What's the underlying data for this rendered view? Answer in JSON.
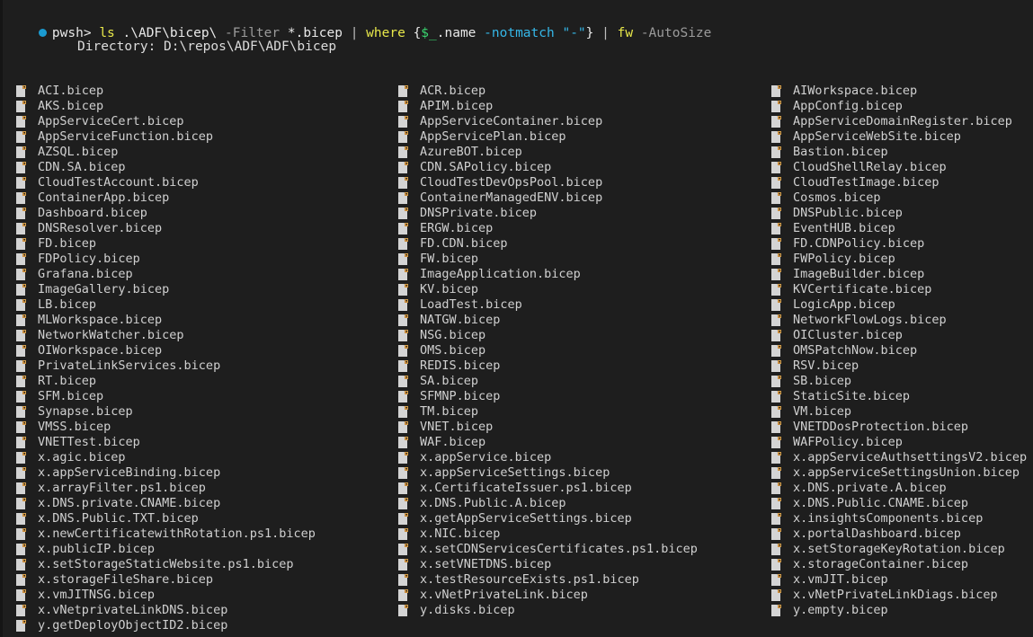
{
  "terminal": {
    "background_color": "#1e1e1e",
    "foreground_color": "#d0d0d0"
  },
  "prompt": {
    "status_icon": "filled-circle-icon",
    "status_icon_color": "#1b9bd1",
    "shell_label": "pwsh>",
    "tokens": [
      {
        "text": "ls",
        "color": "#e8e84a",
        "kind": "command"
      },
      {
        "text": " ",
        "color": "#e8e8e8",
        "kind": "space"
      },
      {
        "text": ".\\ADF\\bicep\\",
        "color": "#e8e8e8",
        "kind": "argument"
      },
      {
        "text": " ",
        "color": "#e8e8e8",
        "kind": "space"
      },
      {
        "text": "-Filter",
        "color": "#9b9b9b",
        "kind": "parameter"
      },
      {
        "text": " ",
        "color": "#e8e8e8",
        "kind": "space"
      },
      {
        "text": "*.bicep",
        "color": "#e8e8e8",
        "kind": "argument"
      },
      {
        "text": " ",
        "color": "#e8e8e8",
        "kind": "space"
      },
      {
        "text": "|",
        "color": "#bdbdbd",
        "kind": "operator"
      },
      {
        "text": " ",
        "color": "#e8e8e8",
        "kind": "space"
      },
      {
        "text": "where",
        "color": "#e8e84a",
        "kind": "command"
      },
      {
        "text": " ",
        "color": "#e8e8e8",
        "kind": "space"
      },
      {
        "text": "{",
        "color": "#e8e8e8",
        "kind": "brace"
      },
      {
        "text": "$_",
        "color": "#3ad66f",
        "kind": "variable"
      },
      {
        "text": ".name",
        "color": "#e8e8e8",
        "kind": "property"
      },
      {
        "text": " ",
        "color": "#e8e8e8",
        "kind": "space"
      },
      {
        "text": "-notmatch",
        "color": "#35b7e8",
        "kind": "operator"
      },
      {
        "text": " ",
        "color": "#e8e8e8",
        "kind": "space"
      },
      {
        "text": "\"-\"",
        "color": "#35b7e8",
        "kind": "string"
      },
      {
        "text": "}",
        "color": "#e8e8e8",
        "kind": "brace"
      },
      {
        "text": " ",
        "color": "#e8e8e8",
        "kind": "space"
      },
      {
        "text": "|",
        "color": "#bdbdbd",
        "kind": "operator"
      },
      {
        "text": " ",
        "color": "#e8e8e8",
        "kind": "space"
      },
      {
        "text": "fw",
        "color": "#e8e84a",
        "kind": "command"
      },
      {
        "text": " ",
        "color": "#e8e8e8",
        "kind": "space"
      },
      {
        "text": "-AutoSize",
        "color": "#9b9b9b",
        "kind": "parameter"
      }
    ],
    "full_command": "ls .\\ADF\\bicep\\ -Filter *.bicep | where {$_.name -notmatch \"-\"} | fw -AutoSize"
  },
  "directory_header": {
    "text": "Directory: D:\\repos\\ADF\\ADF\\bicep"
  },
  "listing": {
    "icon_name": "file-icon",
    "columns": [
      {
        "index": 0,
        "files": [
          "ACI.bicep",
          "AKS.bicep",
          "AppServiceCert.bicep",
          "AppServiceFunction.bicep",
          "AZSQL.bicep",
          "CDN.SA.bicep",
          "CloudTestAccount.bicep",
          "ContainerApp.bicep",
          "Dashboard.bicep",
          "DNSResolver.bicep",
          "FD.bicep",
          "FDPolicy.bicep",
          "Grafana.bicep",
          "ImageGallery.bicep",
          "LB.bicep",
          "MLWorkspace.bicep",
          "NetworkWatcher.bicep",
          "OIWorkspace.bicep",
          "PrivateLinkServices.bicep",
          "RT.bicep",
          "SFM.bicep",
          "Synapse.bicep",
          "VMSS.bicep",
          "VNETTest.bicep",
          "x.agic.bicep",
          "x.appServiceBinding.bicep",
          "x.arrayFilter.ps1.bicep",
          "x.DNS.private.CNAME.bicep",
          "x.DNS.Public.TXT.bicep",
          "x.newCertificatewithRotation.ps1.bicep",
          "x.publicIP.bicep",
          "x.setStorageStaticWebsite.ps1.bicep",
          "x.storageFileShare.bicep",
          "x.vmJITNSG.bicep",
          "x.vNetprivateLinkDNS.bicep",
          "y.getDeployObjectID2.bicep"
        ]
      },
      {
        "index": 1,
        "files": [
          "ACR.bicep",
          "APIM.bicep",
          "AppServiceContainer.bicep",
          "AppServicePlan.bicep",
          "AzureBOT.bicep",
          "CDN.SAPolicy.bicep",
          "CloudTestDevOpsPool.bicep",
          "ContainerManagedENV.bicep",
          "DNSPrivate.bicep",
          "ERGW.bicep",
          "FD.CDN.bicep",
          "FW.bicep",
          "ImageApplication.bicep",
          "KV.bicep",
          "LoadTest.bicep",
          "NATGW.bicep",
          "NSG.bicep",
          "OMS.bicep",
          "REDIS.bicep",
          "SA.bicep",
          "SFMNP.bicep",
          "TM.bicep",
          "VNET.bicep",
          "WAF.bicep",
          "x.appService.bicep",
          "x.appServiceSettings.bicep",
          "x.CertificateIssuer.ps1.bicep",
          "x.DNS.Public.A.bicep",
          "x.getAppServiceSettings.bicep",
          "x.NIC.bicep",
          "x.setCDNServicesCertificates.ps1.bicep",
          "x.setVNETDNS.bicep",
          "x.testResourceExists.ps1.bicep",
          "x.vNetPrivateLink.bicep",
          "y.disks.bicep"
        ]
      },
      {
        "index": 2,
        "files": [
          "AIWorkspace.bicep",
          "AppConfig.bicep",
          "AppServiceDomainRegister.bicep",
          "AppServiceWebSite.bicep",
          "Bastion.bicep",
          "CloudShellRelay.bicep",
          "CloudTestImage.bicep",
          "Cosmos.bicep",
          "DNSPublic.bicep",
          "EventHUB.bicep",
          "FD.CDNPolicy.bicep",
          "FWPolicy.bicep",
          "ImageBuilder.bicep",
          "KVCertificate.bicep",
          "LogicApp.bicep",
          "NetworkFlowLogs.bicep",
          "OICluster.bicep",
          "OMSPatchNow.bicep",
          "RSV.bicep",
          "SB.bicep",
          "StaticSite.bicep",
          "VM.bicep",
          "VNETDDosProtection.bicep",
          "WAFPolicy.bicep",
          "x.appServiceAuthsettingsV2.bicep",
          "x.appServiceSettingsUnion.bicep",
          "x.DNS.private.A.bicep",
          "x.DNS.Public.CNAME.bicep",
          "x.insightsComponents.bicep",
          "x.portalDashboard.bicep",
          "x.setStorageKeyRotation.bicep",
          "x.storageContainer.bicep",
          "x.vmJIT.bicep",
          "x.vNetPrivateLinkDiags.bicep",
          "y.empty.bicep"
        ]
      }
    ]
  }
}
